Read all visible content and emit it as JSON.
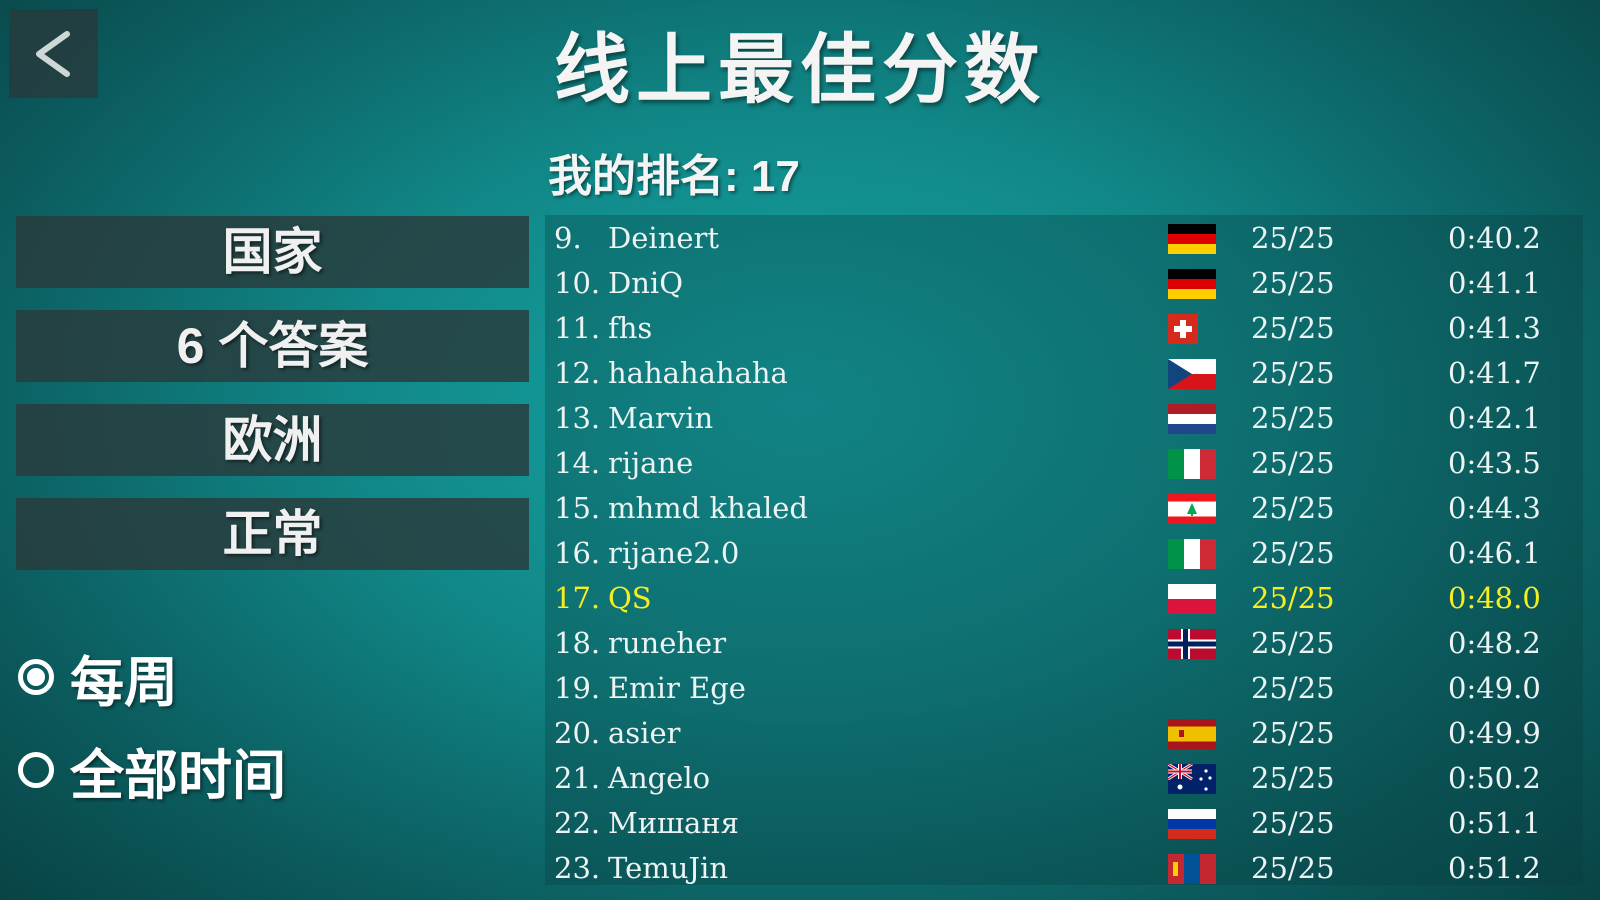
{
  "header": {
    "title": "线上最佳分数",
    "back_icon": "chevron-left-icon"
  },
  "rank": {
    "label": "我的排名:",
    "value": "17"
  },
  "filters": [
    "国家",
    "6 个答案",
    "欧洲",
    "正常"
  ],
  "period": {
    "options": [
      {
        "label": "每周",
        "selected": true
      },
      {
        "label": "全部时间",
        "selected": false
      }
    ]
  },
  "colors": {
    "highlight": "#f4ee22",
    "text": "#ecf3f3",
    "panel": "#2a3a3c"
  },
  "leaderboard": [
    {
      "rank": "9.",
      "name": "Deinert",
      "flag": "germany",
      "score": "25/25",
      "time": "0:40.2"
    },
    {
      "rank": "10.",
      "name": "DniQ",
      "flag": "germany",
      "score": "25/25",
      "time": "0:41.1"
    },
    {
      "rank": "11.",
      "name": "fhs",
      "flag": "switzerland",
      "score": "25/25",
      "time": "0:41.3"
    },
    {
      "rank": "12.",
      "name": "hahahahaha",
      "flag": "czechia",
      "score": "25/25",
      "time": "0:41.7"
    },
    {
      "rank": "13.",
      "name": "Marvin",
      "flag": "netherlands",
      "score": "25/25",
      "time": "0:42.1"
    },
    {
      "rank": "14.",
      "name": "rijane",
      "flag": "italy",
      "score": "25/25",
      "time": "0:43.5"
    },
    {
      "rank": "15.",
      "name": "mhmd khaled",
      "flag": "lebanon",
      "score": "25/25",
      "time": "0:44.3"
    },
    {
      "rank": "16.",
      "name": "rijane2.0",
      "flag": "italy",
      "score": "25/25",
      "time": "0:46.1"
    },
    {
      "rank": "17.",
      "name": "QS",
      "flag": "poland",
      "score": "25/25",
      "time": "0:48.0",
      "me": true
    },
    {
      "rank": "18.",
      "name": "runeher",
      "flag": "norway",
      "score": "25/25",
      "time": "0:48.2"
    },
    {
      "rank": "19.",
      "name": "Emir Ege",
      "flag": "",
      "score": "25/25",
      "time": "0:49.0"
    },
    {
      "rank": "20.",
      "name": "asier",
      "flag": "spain",
      "score": "25/25",
      "time": "0:49.9"
    },
    {
      "rank": "21.",
      "name": "Angelo",
      "flag": "australia",
      "score": "25/25",
      "time": "0:50.2"
    },
    {
      "rank": "22.",
      "name": "Мишаня",
      "flag": "russia",
      "score": "25/25",
      "time": "0:51.1"
    },
    {
      "rank": "23.",
      "name": "TemuJin",
      "flag": "mongolia",
      "score": "25/25",
      "time": "0:51.2"
    }
  ]
}
